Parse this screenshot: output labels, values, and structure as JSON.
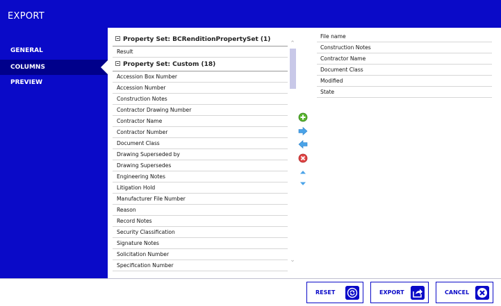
{
  "window": {
    "title": "EXPORT"
  },
  "nav": {
    "items": [
      {
        "label": "GENERAL"
      },
      {
        "label": "COLUMNS"
      },
      {
        "label": "PREVIEW"
      }
    ]
  },
  "available": {
    "groups": [
      {
        "header": "Property Set: BCRenditionPropertySet (1)",
        "items": [
          "Result"
        ]
      },
      {
        "header": "Property Set: Custom (18)",
        "items": [
          "Accession Box Number",
          "Accession Number",
          "Construction Notes",
          "Contractor Drawing Number",
          "Contractor Name",
          "Contractor Number",
          "Document Class",
          "Drawing Superseded by",
          "Drawing Supersedes",
          "Engineering Notes",
          "Litigation Hold",
          "Manufacturer File Number",
          "Reason",
          "Record Notes",
          "Security Classification",
          "Signature Notes",
          "Solicitation Number",
          "Specification Number"
        ]
      }
    ]
  },
  "actions": [
    {
      "icon": "add-icon"
    },
    {
      "icon": "move-right-icon"
    },
    {
      "icon": "move-left-icon"
    },
    {
      "icon": "remove-icon"
    },
    {
      "icon": "move-up-icon"
    },
    {
      "icon": "move-down-icon"
    }
  ],
  "selected": {
    "items": [
      "File name",
      "Construction Notes",
      "Contractor Name",
      "Document Class",
      "Modified",
      "State"
    ]
  },
  "footer": {
    "reset_label": "RESET",
    "export_label": "EXPORT",
    "cancel_label": "CANCEL"
  },
  "colors": {
    "brand": "#0a0ac8",
    "nav_active": "#00008b",
    "add": "#5ab52f",
    "arrow": "#4aa3e8",
    "remove": "#e04545"
  }
}
